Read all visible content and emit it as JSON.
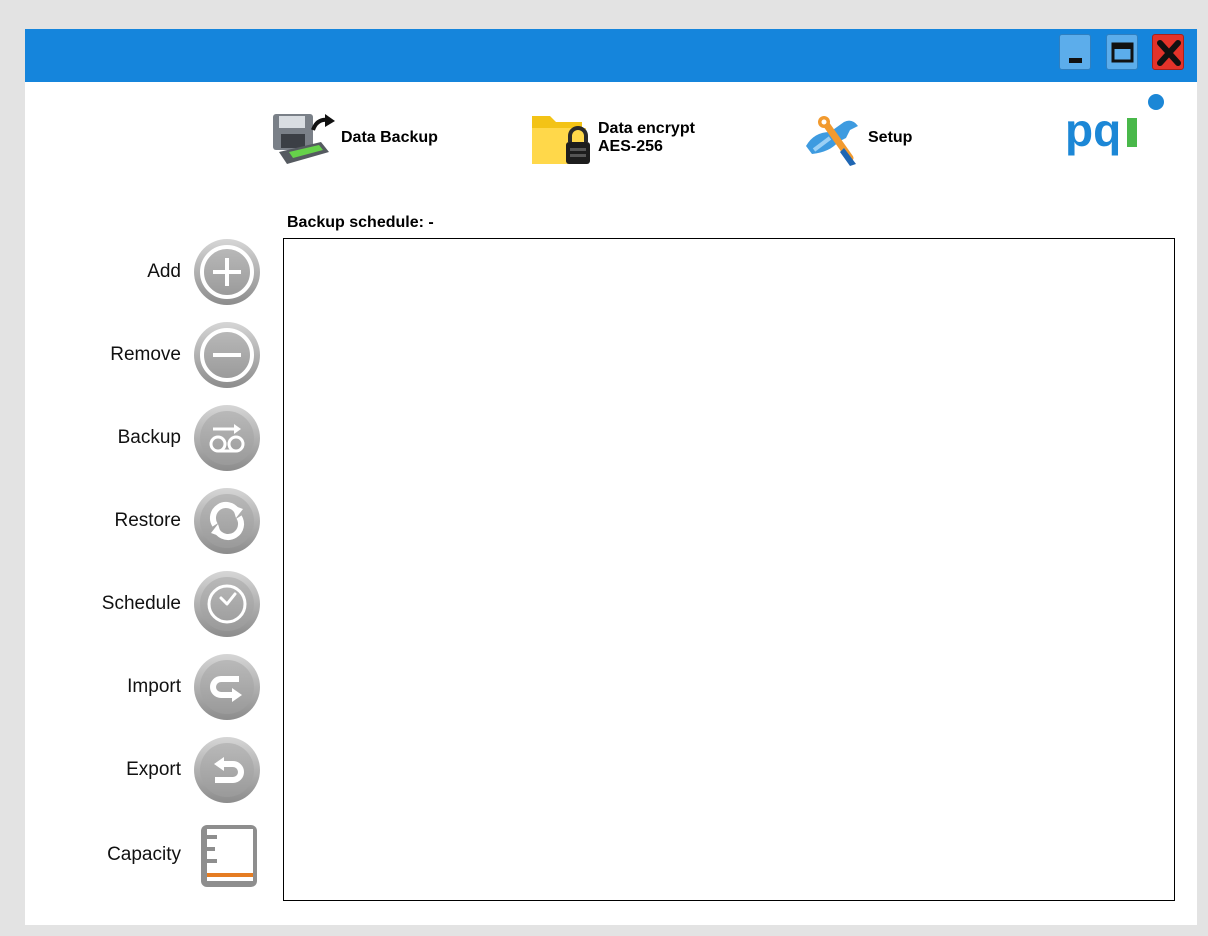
{
  "window": {
    "controls": {
      "minimize_icon": "minimize-icon",
      "maximize_icon": "maximize-icon",
      "close_icon": "close-icon"
    },
    "colors": {
      "titlebar": "#1585dc",
      "close": "#e4332a",
      "brand_blue": "#1c87d6",
      "brand_green": "#49b84a"
    }
  },
  "topnav": {
    "data_backup": {
      "label": "Data Backup",
      "icon": "backup-drive-icon"
    },
    "data_encrypt": {
      "label": "Data encrypt\nAES-256",
      "icon": "encrypted-folder-icon"
    },
    "setup": {
      "label": "Setup",
      "icon": "tools-icon"
    }
  },
  "logo": {
    "text": "pqi"
  },
  "schedule": {
    "label": "Backup schedule: -"
  },
  "sidebar": {
    "items": [
      {
        "label": "Add",
        "icon": "plus-circle-icon"
      },
      {
        "label": "Remove",
        "icon": "minus-circle-icon"
      },
      {
        "label": "Backup",
        "icon": "backup-circle-icon"
      },
      {
        "label": "Restore",
        "icon": "restore-circle-icon"
      },
      {
        "label": "Schedule",
        "icon": "clock-circle-icon"
      },
      {
        "label": "Import",
        "icon": "import-circle-icon"
      },
      {
        "label": "Export",
        "icon": "export-circle-icon"
      },
      {
        "label": "Capacity",
        "icon": "capacity-gauge-icon"
      }
    ]
  }
}
